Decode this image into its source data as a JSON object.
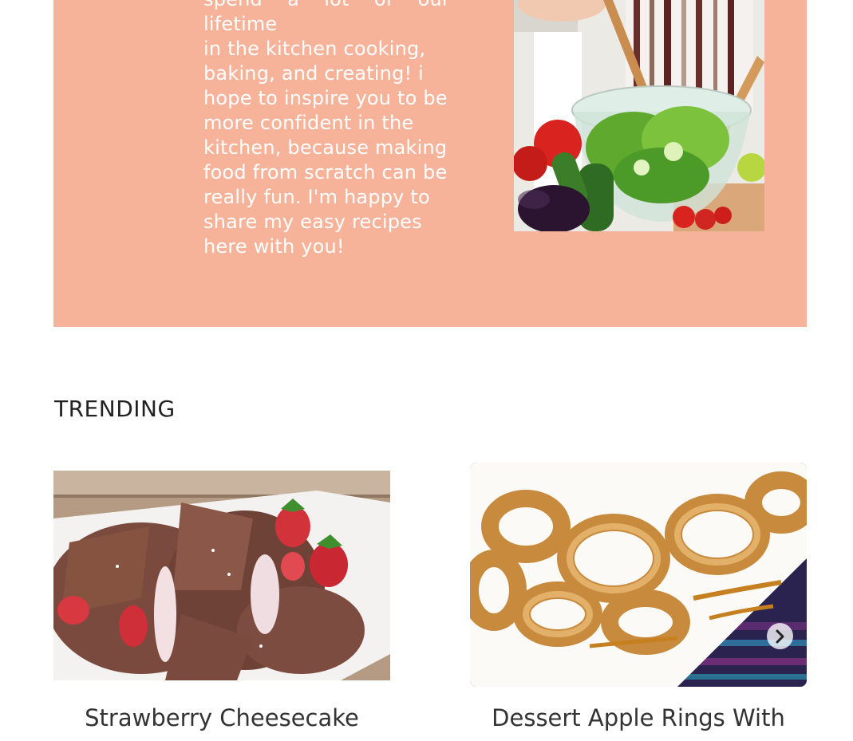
{
  "about": {
    "text_lines": [
      "spend a lot of our lifetime",
      "in the kitchen cooking,",
      "baking, and creating! i",
      "hope to inspire you to be",
      "more confident in the",
      "kitchen, because making",
      "food from scratch can be",
      "really fun. I'm happy to",
      "share my easy recipes",
      "here with you!"
    ],
    "photo_icon": "salad-bowl-photo"
  },
  "trending": {
    "heading": "TRENDING",
    "cards": [
      {
        "title_line1": "Strawberry Cheesecake",
        "image": "chocolate-crepes-photo"
      },
      {
        "title_line1": "Dessert Apple Rings With",
        "image": "apple-rings-photo"
      }
    ],
    "next_icon": "chevron-right-icon"
  },
  "colors": {
    "about_background": "#f7b39a",
    "text_white": "#ffffff",
    "heading": "#222222"
  }
}
